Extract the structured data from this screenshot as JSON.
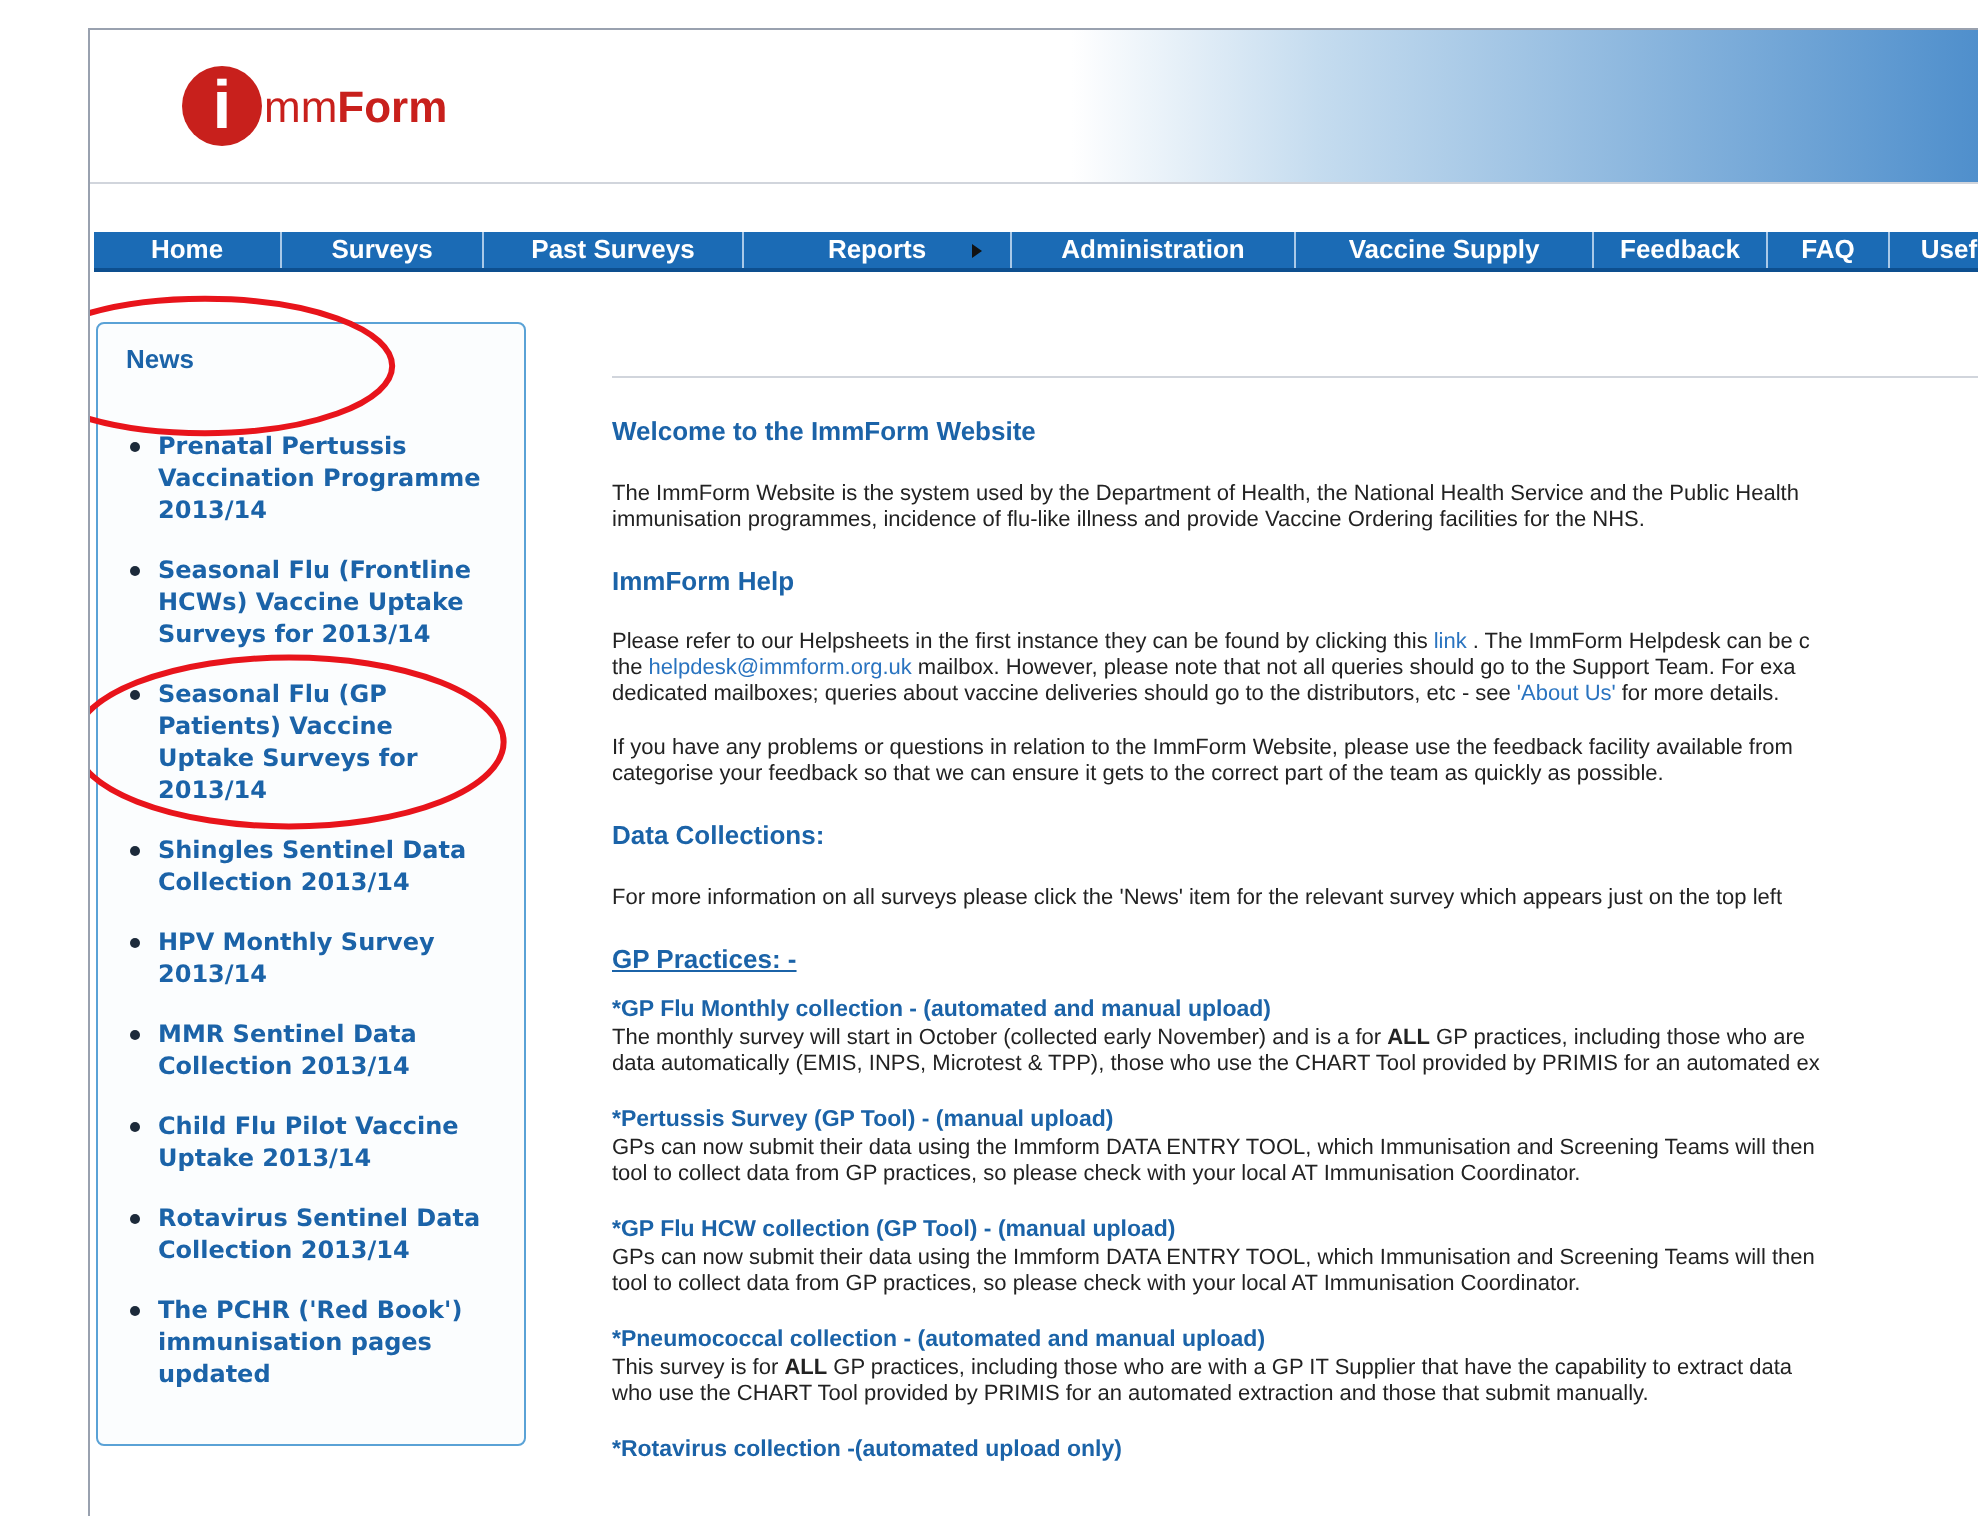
{
  "logo": {
    "initial": "i",
    "rest_light": "mm",
    "rest_bold": "Form"
  },
  "nav": [
    {
      "label": "Home",
      "has_submenu": false
    },
    {
      "label": "Surveys",
      "has_submenu": false
    },
    {
      "label": "Past Surveys",
      "has_submenu": false
    },
    {
      "label": "Reports",
      "has_submenu": true
    },
    {
      "label": "Administration",
      "has_submenu": false
    },
    {
      "label": "Vaccine Supply",
      "has_submenu": false
    },
    {
      "label": "Feedback",
      "has_submenu": false
    },
    {
      "label": "FAQ",
      "has_submenu": false
    },
    {
      "label": "Usef",
      "has_submenu": false
    }
  ],
  "news": {
    "title": "News",
    "circled": true,
    "items": [
      {
        "label": "Prenatal Pertussis Vaccination Programme 2013/14",
        "circled": false
      },
      {
        "label": "Seasonal Flu (Frontline HCWs) Vaccine Uptake Surveys for 2013/14",
        "circled": false
      },
      {
        "label": "Seasonal Flu (GP Patients) Vaccine Uptake Surveys for 2013/14",
        "circled": true
      },
      {
        "label": "Shingles Sentinel Data Collection 2013/14",
        "circled": false
      },
      {
        "label": "HPV Monthly Survey 2013/14",
        "circled": false
      },
      {
        "label": "MMR Sentinel Data Collection 2013/14",
        "circled": false
      },
      {
        "label": "Child Flu Pilot Vaccine Uptake 2013/14",
        "circled": false
      },
      {
        "label": "Rotavirus Sentinel Data Collection 2013/14",
        "circled": false
      },
      {
        "label": "The PCHR ('Red Book') immunisation pages updated",
        "circled": false
      }
    ]
  },
  "content": [
    {
      "kind": "heading",
      "text": "Welcome to the ImmForm Website"
    },
    {
      "kind": "paragraph",
      "lines": [
        [
          {
            "text": "The ImmForm Website is the system used by the Department of Health, the National Health Service and the Public Health",
            "link": false
          }
        ],
        [
          {
            "text": "immunisation programmes, incidence of flu-like illness and provide Vaccine Ordering facilities for the NHS.",
            "link": false
          }
        ]
      ]
    },
    {
      "kind": "heading",
      "text": "ImmForm Help"
    },
    {
      "kind": "paragraph",
      "lines": [
        [
          {
            "text": "Please refer to our Helpsheets in the first instance they can be found by clicking this",
            "link": false
          },
          {
            "text": "link",
            "link": true
          },
          {
            "text": ". The ImmForm Helpdesk can be c",
            "link": false
          }
        ],
        [
          {
            "text": "the",
            "link": false
          },
          {
            "text": "helpdesk@immform.org.uk",
            "link": true
          },
          {
            "text": "mailbox. However, please note that not all queries should go to the Support Team. For exa",
            "link": false
          }
        ],
        [
          {
            "text": "dedicated mailboxes; queries about vaccine deliveries should go to the distributors, etc - see",
            "link": false
          },
          {
            "text": "'About Us'",
            "link": true
          },
          {
            "text": "for more details.",
            "link": false
          }
        ]
      ]
    },
    {
      "kind": "paragraph",
      "lines": [
        [
          {
            "text": "If you have any problems or questions in relation to the ImmForm Website, please use the feedback facility available from",
            "link": false
          }
        ],
        [
          {
            "text": "categorise your feedback so that we can ensure it gets to the correct part of the team as quickly as possible.",
            "link": false
          }
        ]
      ]
    },
    {
      "kind": "heading",
      "text": "Data Collections:"
    },
    {
      "kind": "paragraph",
      "lines": [
        [
          {
            "text": "For more information on all surveys please click the 'News' item for the relevant survey which appears just on the top left",
            "link": false
          }
        ]
      ]
    },
    {
      "kind": "section_link",
      "text": "GP Practices: -"
    },
    {
      "kind": "subheading",
      "text": "*GP Flu Monthly collection - (automated and manual upload)"
    },
    {
      "kind": "paragraph",
      "lines": [
        [
          {
            "text": "The monthly survey will start in October (collected early November) and is a for **ALL** GP practices, including those who are",
            "link": false
          }
        ],
        [
          {
            "text": "data automatically (EMIS, INPS, Microtest & TPP), those who use the CHART Tool provided by PRIMIS for an automated ex",
            "link": false
          }
        ]
      ]
    },
    {
      "kind": "subheading",
      "text": "*Pertussis Survey (GP Tool) - (manual upload)"
    },
    {
      "kind": "paragraph",
      "lines": [
        [
          {
            "text": "GPs can now submit their data using the Immform DATA ENTRY TOOL, which Immunisation and Screening Teams will then",
            "link": false
          }
        ],
        [
          {
            "text": "tool to collect data from GP practices, so please check with your local AT Immunisation Coordinator.",
            "link": false
          }
        ]
      ]
    },
    {
      "kind": "subheading",
      "text": "*GP Flu HCW collection (GP Tool) - (manual upload)"
    },
    {
      "kind": "paragraph",
      "lines": [
        [
          {
            "text": "GPs can now submit their data using the Immform DATA ENTRY TOOL, which Immunisation and Screening Teams will then",
            "link": false
          }
        ],
        [
          {
            "text": "tool to collect data from GP practices, so please check with your local AT Immunisation Coordinator.",
            "link": false
          }
        ]
      ]
    },
    {
      "kind": "subheading",
      "text": "*Pneumococcal collection - (automated and manual upload)"
    },
    {
      "kind": "paragraph",
      "lines": [
        [
          {
            "text": "This survey is for **ALL** GP practices, including those who are with a GP IT Supplier that have the capability to extract data",
            "link": false
          }
        ],
        [
          {
            "text": "who use the CHART Tool provided by PRIMIS for an automated extraction and those that submit manually.",
            "link": false
          }
        ]
      ]
    },
    {
      "kind": "subheading",
      "text": "*Rotavirus collection -(automated upload only)"
    }
  ]
}
